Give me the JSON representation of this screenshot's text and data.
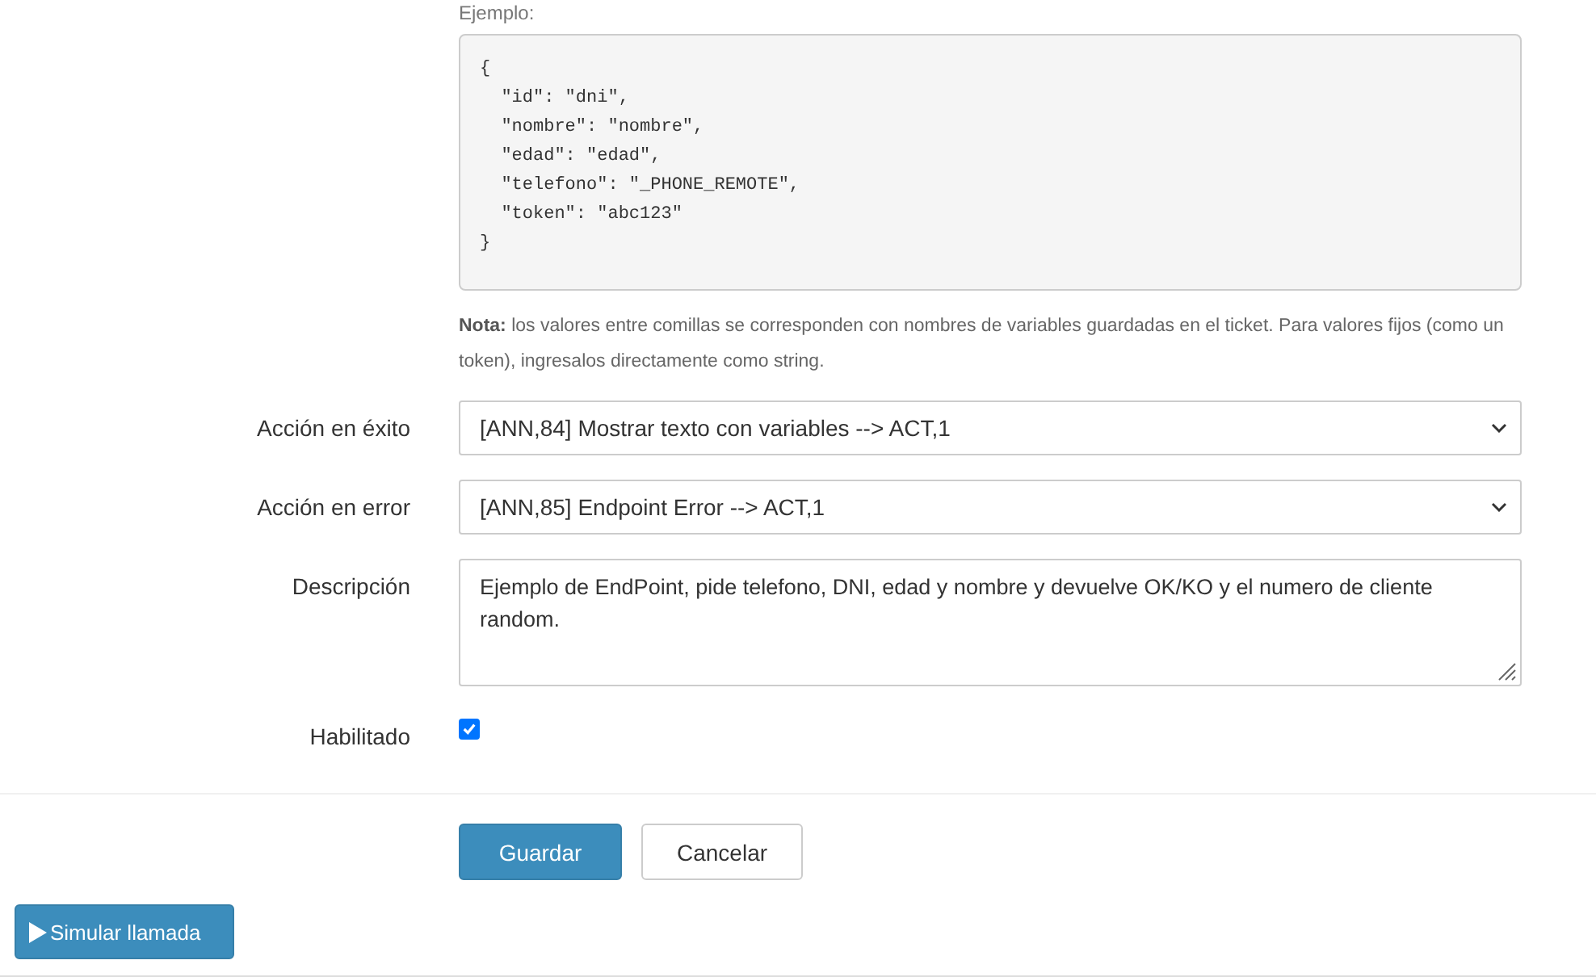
{
  "example": {
    "label": "Ejemplo:",
    "code": "{\n  \"id\": \"dni\",\n  \"nombre\": \"nombre\",\n  \"edad\": \"edad\",\n  \"telefono\": \"_PHONE_REMOTE\",\n  \"token\": \"abc123\"\n}"
  },
  "note": "**Nota:** los valores entre comillas se corresponden con nombres de variables guardadas en el ticket. Para valores fijos (como un token), ingresalos directamente como string.",
  "fields": [
    {
      "kind": "select",
      "label": "Acción en éxito",
      "value": "[ANN,84] Mostrar texto con variables --> ACT,1"
    },
    {
      "kind": "select",
      "label": "Acción en error",
      "value": "[ANN,85] Endpoint Error --> ACT,1"
    },
    {
      "kind": "textarea",
      "label": "Descripción",
      "value": "Ejemplo de EndPoint, pide telefono, DNI, edad y nombre y devuelve OK/KO y el numero de cliente random."
    },
    {
      "kind": "checkbox",
      "label": "Habilitado",
      "checked": true
    }
  ],
  "buttons": [
    {
      "kind": "primary",
      "label": "Guardar"
    },
    {
      "kind": "default",
      "label": "Cancelar"
    }
  ],
  "simulate_button": {
    "label": "Simular llamada"
  }
}
